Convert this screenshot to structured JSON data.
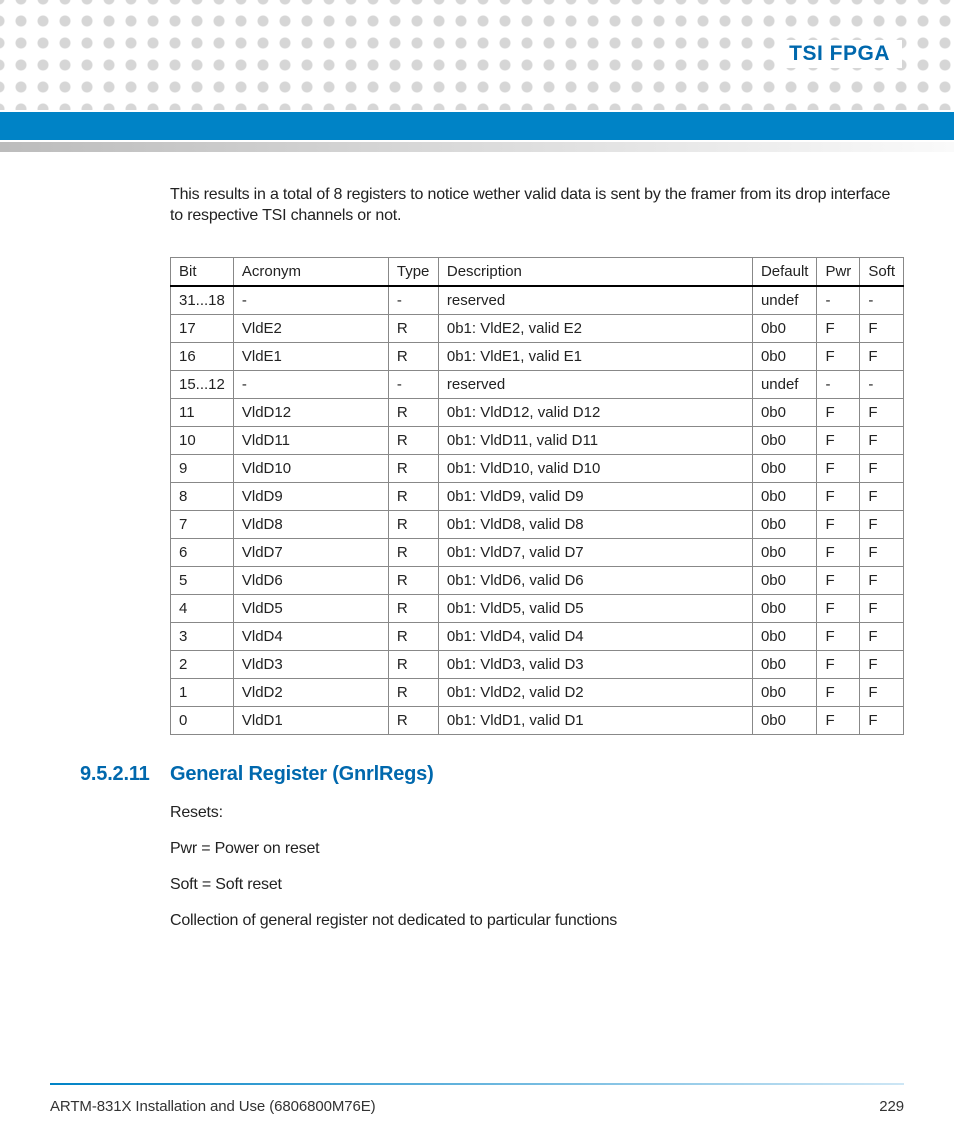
{
  "header": {
    "title": "TSI FPGA"
  },
  "intro": "This results in a total of 8 registers to notice wether valid data is sent by the framer from its drop interface to respective TSI channels or not.",
  "table": {
    "headers": {
      "bit": "Bit",
      "acronym": "Acronym",
      "type": "Type",
      "description": "Description",
      "default": "Default",
      "pwr": "Pwr",
      "soft": "Soft"
    },
    "rows": [
      {
        "bit": "31...18",
        "acronym": "-",
        "type": "-",
        "description": "reserved",
        "default": "undef",
        "pwr": "-",
        "soft": "-"
      },
      {
        "bit": "17",
        "acronym": "VldE2",
        "type": "R",
        "description": "0b1: VldE2, valid E2",
        "default": "0b0",
        "pwr": "F",
        "soft": "F"
      },
      {
        "bit": "16",
        "acronym": "VldE1",
        "type": "R",
        "description": "0b1: VldE1, valid E1",
        "default": "0b0",
        "pwr": "F",
        "soft": "F"
      },
      {
        "bit": "15...12",
        "acronym": "-",
        "type": "-",
        "description": "reserved",
        "default": "undef",
        "pwr": "-",
        "soft": "-"
      },
      {
        "bit": "11",
        "acronym": "VldD12",
        "type": "R",
        "description": "0b1: VldD12, valid D12",
        "default": "0b0",
        "pwr": "F",
        "soft": "F"
      },
      {
        "bit": "10",
        "acronym": "VldD11",
        "type": "R",
        "description": "0b1: VldD11, valid D11",
        "default": "0b0",
        "pwr": "F",
        "soft": "F"
      },
      {
        "bit": "9",
        "acronym": "VldD10",
        "type": "R",
        "description": "0b1: VldD10, valid D10",
        "default": "0b0",
        "pwr": "F",
        "soft": "F"
      },
      {
        "bit": "8",
        "acronym": "VldD9",
        "type": "R",
        "description": "0b1: VldD9, valid D9",
        "default": "0b0",
        "pwr": "F",
        "soft": "F"
      },
      {
        "bit": "7",
        "acronym": "VldD8",
        "type": "R",
        "description": "0b1: VldD8, valid D8",
        "default": "0b0",
        "pwr": "F",
        "soft": "F"
      },
      {
        "bit": "6",
        "acronym": "VldD7",
        "type": "R",
        "description": "0b1: VldD7, valid D7",
        "default": "0b0",
        "pwr": "F",
        "soft": "F"
      },
      {
        "bit": "5",
        "acronym": "VldD6",
        "type": "R",
        "description": "0b1: VldD6, valid D6",
        "default": "0b0",
        "pwr": "F",
        "soft": "F"
      },
      {
        "bit": "4",
        "acronym": "VldD5",
        "type": "R",
        "description": "0b1: VldD5, valid D5",
        "default": "0b0",
        "pwr": "F",
        "soft": "F"
      },
      {
        "bit": "3",
        "acronym": "VldD4",
        "type": "R",
        "description": "0b1: VldD4, valid D4",
        "default": "0b0",
        "pwr": "F",
        "soft": "F"
      },
      {
        "bit": "2",
        "acronym": "VldD3",
        "type": "R",
        "description": "0b1: VldD3, valid D3",
        "default": "0b0",
        "pwr": "F",
        "soft": "F"
      },
      {
        "bit": "1",
        "acronym": "VldD2",
        "type": "R",
        "description": "0b1: VldD2, valid D2",
        "default": "0b0",
        "pwr": "F",
        "soft": "F"
      },
      {
        "bit": "0",
        "acronym": "VldD1",
        "type": "R",
        "description": "0b1: VldD1, valid D1",
        "default": "0b0",
        "pwr": "F",
        "soft": "F"
      }
    ]
  },
  "section": {
    "number": "9.5.2.11",
    "title": "General Register (GnrlRegs)",
    "paragraphs": [
      "Resets:",
      "Pwr = Power on reset",
      "Soft = Soft reset",
      "Collection of general register not dedicated to particular functions"
    ]
  },
  "footer": {
    "left": "ARTM-831X Installation and Use (6806800M76E)",
    "right": "229"
  }
}
